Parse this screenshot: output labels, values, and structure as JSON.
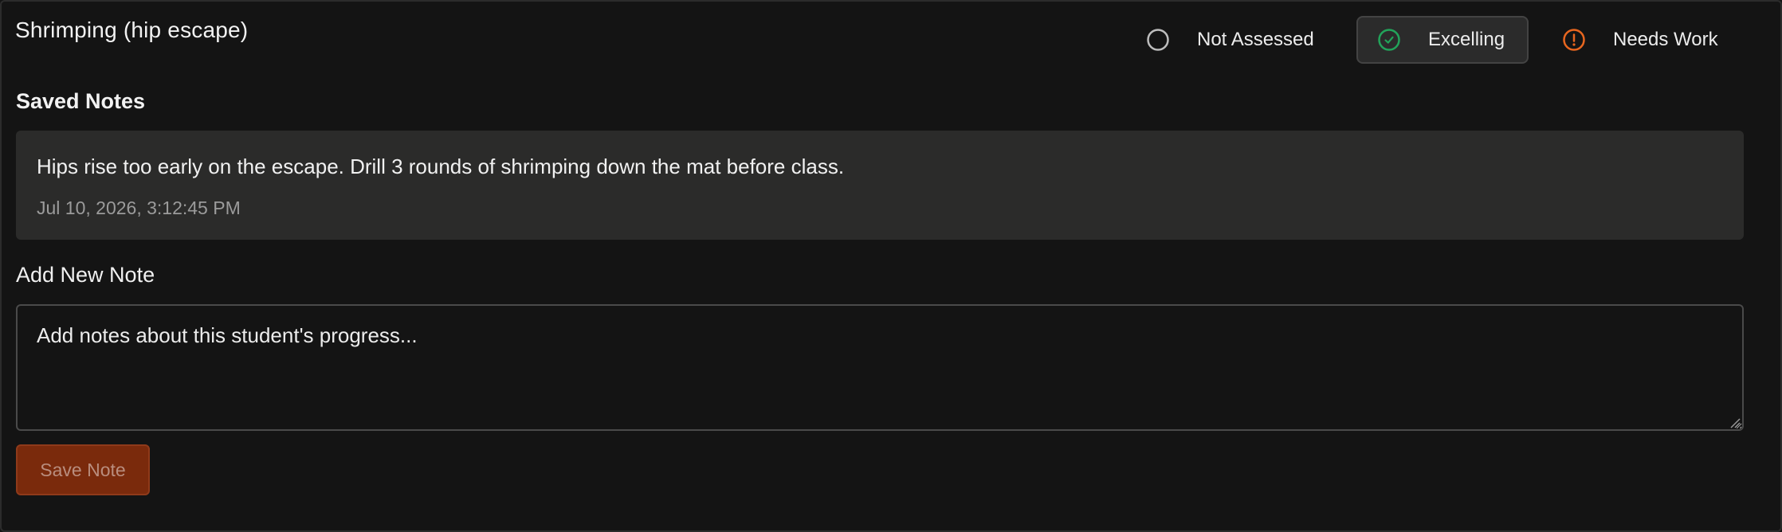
{
  "skill": {
    "title": "Shrimping (hip escape)"
  },
  "status": {
    "options": [
      {
        "label": "Not Assessed",
        "icon": "empty-circle-icon",
        "color": "#bdbdbd",
        "selected": false
      },
      {
        "label": "Excelling",
        "icon": "check-circle-icon",
        "color": "#22a35a",
        "selected": true
      },
      {
        "label": "Needs Work",
        "icon": "alert-circle-icon",
        "color": "#e8661f",
        "selected": false
      }
    ]
  },
  "saved_notes": {
    "heading": "Saved Notes",
    "items": [
      {
        "text": "Hips rise too early on the escape. Drill 3 rounds of shrimping down the mat before class.",
        "timestamp": "Jul 10, 2026, 3:12:45 PM"
      }
    ]
  },
  "add_note": {
    "heading": "Add New Note",
    "placeholder": "Add notes about this student's progress...",
    "value": ""
  },
  "actions": {
    "save_label": "Save Note",
    "save_disabled": true
  },
  "colors": {
    "background": "#141414",
    "note_background": "#2b2b2a",
    "accent": "#7a2a0c",
    "success": "#22a35a",
    "warning": "#e8661f"
  }
}
